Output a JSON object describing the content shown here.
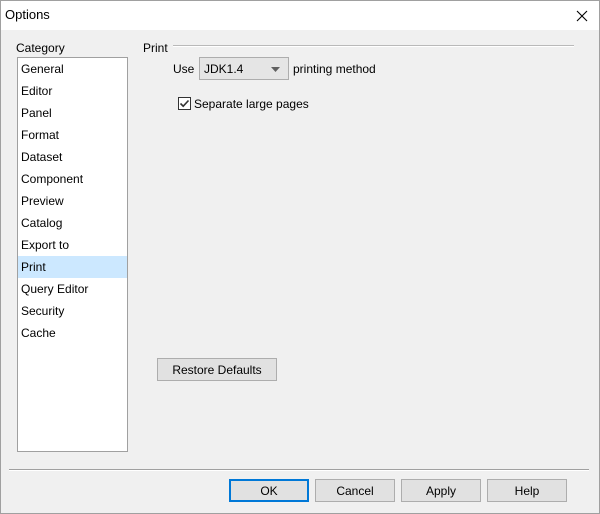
{
  "window": {
    "title": "Options",
    "close_icon": "close-icon"
  },
  "category": {
    "label": "Category",
    "items": [
      "General",
      "Editor",
      "Panel",
      "Format",
      "Dataset",
      "Component",
      "Preview",
      "Catalog",
      "Export to",
      "Print",
      "Query Editor",
      "Security",
      "Cache"
    ],
    "selected": "Print"
  },
  "print": {
    "group_title": "Print",
    "use_label": "Use",
    "method_value": "JDK1.4",
    "method_suffix": "printing method",
    "separate_label": "Separate large pages",
    "separate_checked": true
  },
  "buttons": {
    "restore": "Restore Defaults",
    "ok": "OK",
    "cancel": "Cancel",
    "apply": "Apply",
    "help": "Help"
  },
  "colors": {
    "selection": "#cce8ff",
    "default_button_border": "#0078d7"
  }
}
